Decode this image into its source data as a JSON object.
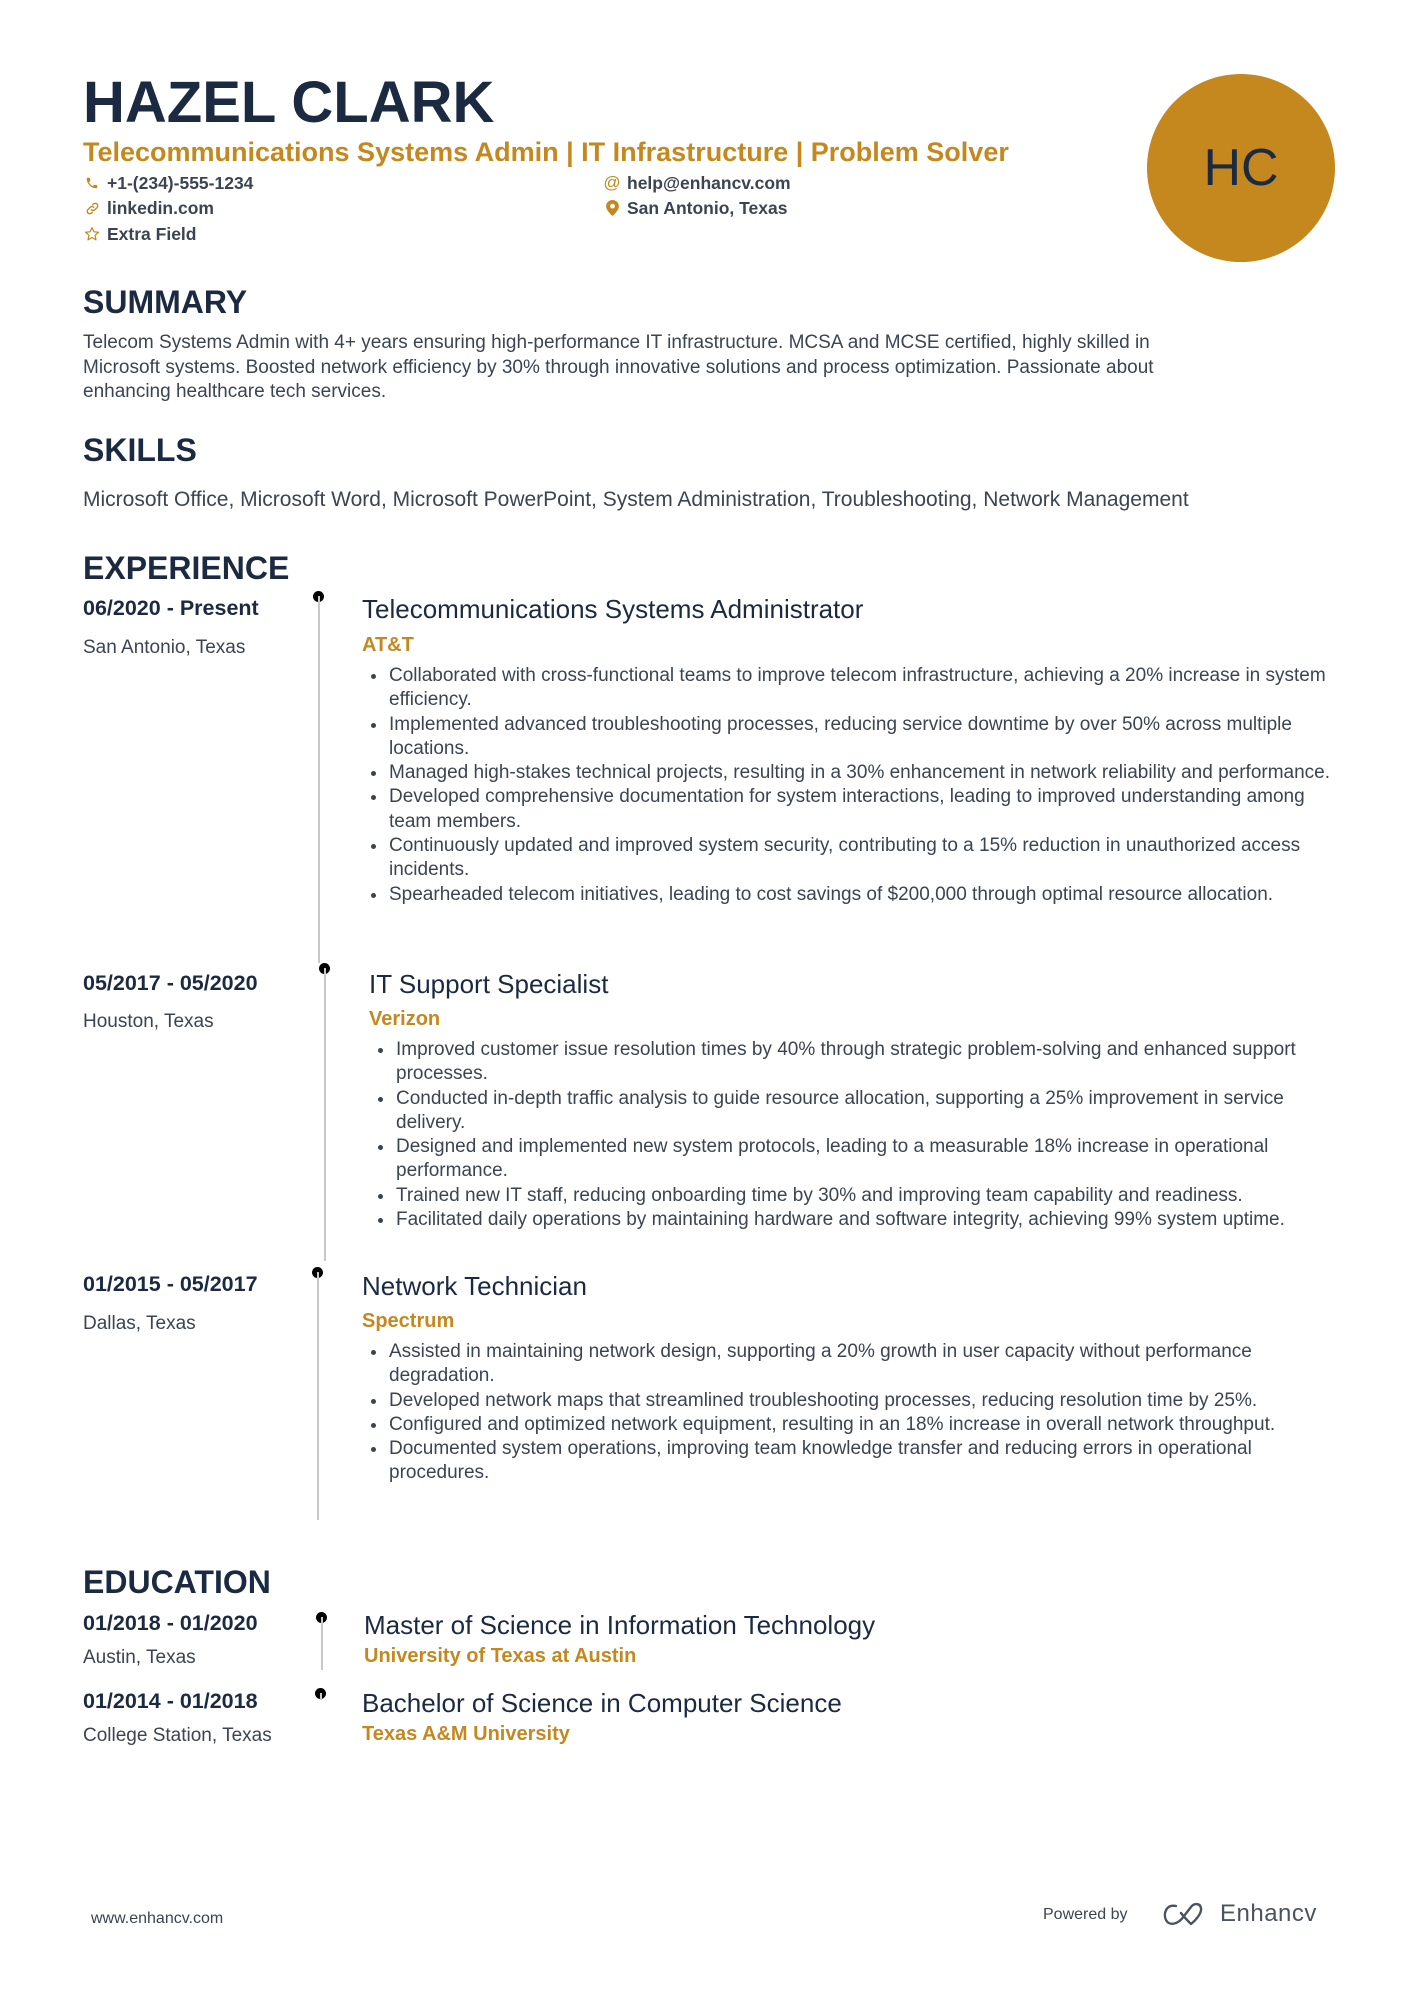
{
  "header": {
    "name": "HAZEL CLARK",
    "tagline": "Telecommunications Systems Admin | IT Infrastructure | Problem Solver",
    "initials": "HC",
    "contacts": [
      {
        "icon": "phone-icon",
        "value": "+1-(234)-555-1234"
      },
      {
        "icon": "at-icon",
        "value": "help@enhancv.com"
      },
      {
        "icon": "link-icon",
        "value": "linkedin.com"
      },
      {
        "icon": "location-pin-icon",
        "value": "San Antonio, Texas"
      },
      {
        "icon": "star-icon",
        "value": "Extra Field"
      }
    ]
  },
  "summary": {
    "heading": "SUMMARY",
    "lines": [
      "Telecom Systems Admin with 4+ years ensuring high-performance IT infrastructure. MCSA and MCSE certified, highly skilled in",
      "Microsoft systems. Boosted network efficiency by 30% through innovative solutions and process optimization. Passionate about",
      "enhancing healthcare tech services."
    ]
  },
  "skills": {
    "heading": "SKILLS",
    "text": "Microsoft Office, Microsoft Word, Microsoft PowerPoint, System Administration, Troubleshooting, Network Management"
  },
  "experience": {
    "heading": "EXPERIENCE",
    "items": [
      {
        "dates": "06/2020 - Present",
        "location": "San Antonio, Texas",
        "title": "Telecommunications Systems Administrator",
        "company": "AT&T",
        "bullets": [
          "Collaborated with cross-functional teams to improve telecom infrastructure, achieving a 20% increase in system efficiency.",
          "Implemented advanced troubleshooting processes, reducing service downtime by over 50% across multiple locations.",
          "Managed high-stakes technical projects, resulting in a 30% enhancement in network reliability and performance.",
          "Developed comprehensive documentation for system interactions, leading to improved understanding among team members.",
          "Continuously updated and improved system security, contributing to a 15% reduction in unauthorized access incidents.",
          "Spearheaded telecom initiatives, leading to cost savings of $200,000 through optimal resource allocation."
        ]
      },
      {
        "dates": "05/2017 - 05/2020",
        "location": "Houston, Texas",
        "title": "IT Support Specialist",
        "company": "Verizon",
        "bullets": [
          "Improved customer issue resolution times by 40% through strategic problem-solving and enhanced support processes.",
          "Conducted in-depth traffic analysis to guide resource allocation, supporting a 25% improvement in service delivery.",
          "Designed and implemented new system protocols, leading to a measurable 18% increase in operational performance.",
          "Trained new IT staff, reducing onboarding time by 30% and improving team capability and readiness.",
          "Facilitated daily operations by maintaining hardware and software integrity, achieving 99% system uptime."
        ]
      },
      {
        "dates": "01/2015 - 05/2017",
        "location": "Dallas, Texas",
        "title": "Network Technician",
        "company": "Spectrum",
        "bullets": [
          "Assisted in maintaining network design, supporting a 20% growth in user capacity without performance degradation.",
          "Developed network maps that streamlined troubleshooting processes, reducing resolution time by 25%.",
          "Configured and optimized network equipment, resulting in an 18% increase in overall network throughput.",
          "Documented system operations, improving team knowledge transfer and reducing errors in operational procedures."
        ]
      }
    ]
  },
  "education": {
    "heading": "EDUCATION",
    "items": [
      {
        "dates": "01/2018 - 01/2020",
        "location": "Austin, Texas",
        "degree": "Master of Science in Information Technology",
        "school": "University of Texas at Austin"
      },
      {
        "dates": "01/2014 - 01/2018",
        "location": "College Station, Texas",
        "degree": "Bachelor of Science in Computer Science",
        "school": "Texas A&M University"
      }
    ]
  },
  "footer": {
    "url": "www.enhancv.com",
    "powered_by": "Powered by",
    "brand": "Enhancv"
  },
  "colors": {
    "accent": "#c4881e",
    "heading": "#1b2a41",
    "body": "#3a4551"
  }
}
